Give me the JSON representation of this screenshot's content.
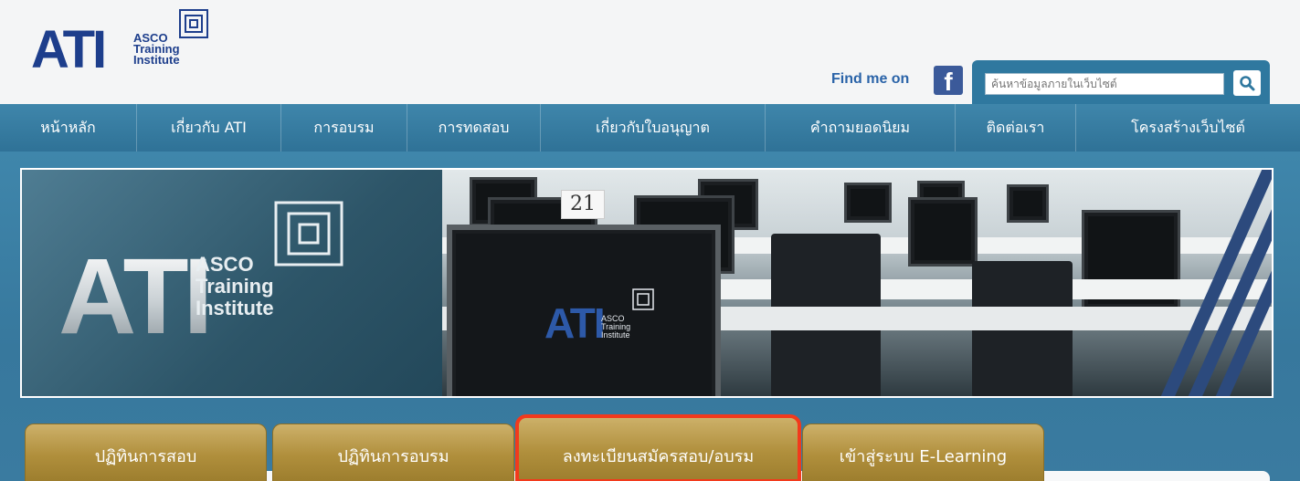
{
  "header": {
    "logo": {
      "main": "ATI",
      "line1": "ASCO",
      "line2": "Training",
      "line3": "Institute"
    },
    "find_me_on": "Find me on",
    "facebook_icon": "facebook-icon",
    "search": {
      "placeholder": "ค้นหาข้อมูลภายในเว็บไซต์",
      "button_icon": "search-icon"
    }
  },
  "nav": {
    "items": [
      {
        "label": "หน้าหลัก"
      },
      {
        "label": "เกี่ยวกับ ATI"
      },
      {
        "label": "การอบรม"
      },
      {
        "label": "การทดสอบ"
      },
      {
        "label": "เกี่ยวกับใบอนุญาต"
      },
      {
        "label": "คำถามยอดนิยม"
      },
      {
        "label": "ติดต่อเรา"
      },
      {
        "label": "โครงสร้างเว็บไซต์"
      }
    ]
  },
  "banner": {
    "logo": {
      "main": "ATI",
      "line1": "ASCO",
      "line2": "Training",
      "line3": "Institute"
    },
    "seat_number": "21",
    "monitor_logo": {
      "main": "ATI",
      "line1": "ASCO",
      "line2": "Training",
      "line3": "Institute"
    }
  },
  "tabs": [
    {
      "label": "ปฏิทินการสอบ"
    },
    {
      "label": "ปฏิทินการอบรม"
    },
    {
      "label": "ลงทะเบียนสมัครสอบ/อบรม",
      "highlighted": true
    },
    {
      "label": "เข้าสู่ระบบ E-Learning"
    }
  ],
  "colors": {
    "brand_blue": "#1d3e8c",
    "nav_blue": "#3f86ab",
    "tab_gold": "#b08f3c",
    "highlight_red": "#f23a1c"
  }
}
